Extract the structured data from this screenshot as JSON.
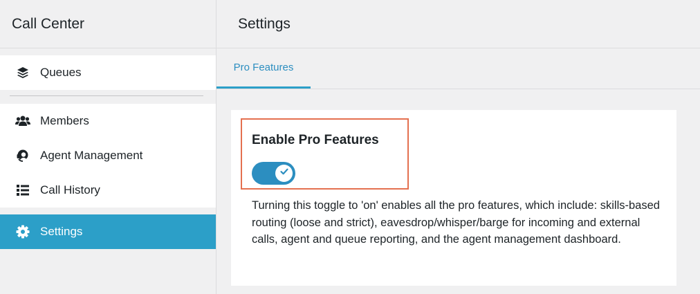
{
  "sidebar": {
    "title": "Call Center",
    "items": [
      {
        "label": "Queues",
        "icon": "layers-icon"
      },
      {
        "label": "Members",
        "icon": "users-icon"
      },
      {
        "label": "Agent Management",
        "icon": "headset-icon"
      },
      {
        "label": "Call History",
        "icon": "list-icon"
      },
      {
        "label": "Settings",
        "icon": "gear-icon",
        "active": true
      }
    ]
  },
  "main": {
    "title": "Settings",
    "tabs": [
      {
        "label": "Pro Features",
        "active": true
      }
    ],
    "feature": {
      "title": "Enable Pro Features",
      "toggle_on": true,
      "description": "Turning this toggle to 'on' enables all the pro features, which include: skills-based routing (loose and strict), eavesdrop/whisper/barge for incoming and external calls, agent and queue reporting, and the agent management dashboard."
    }
  },
  "colors": {
    "accent": "#2c9fc8",
    "highlight_border": "#e4704f"
  }
}
